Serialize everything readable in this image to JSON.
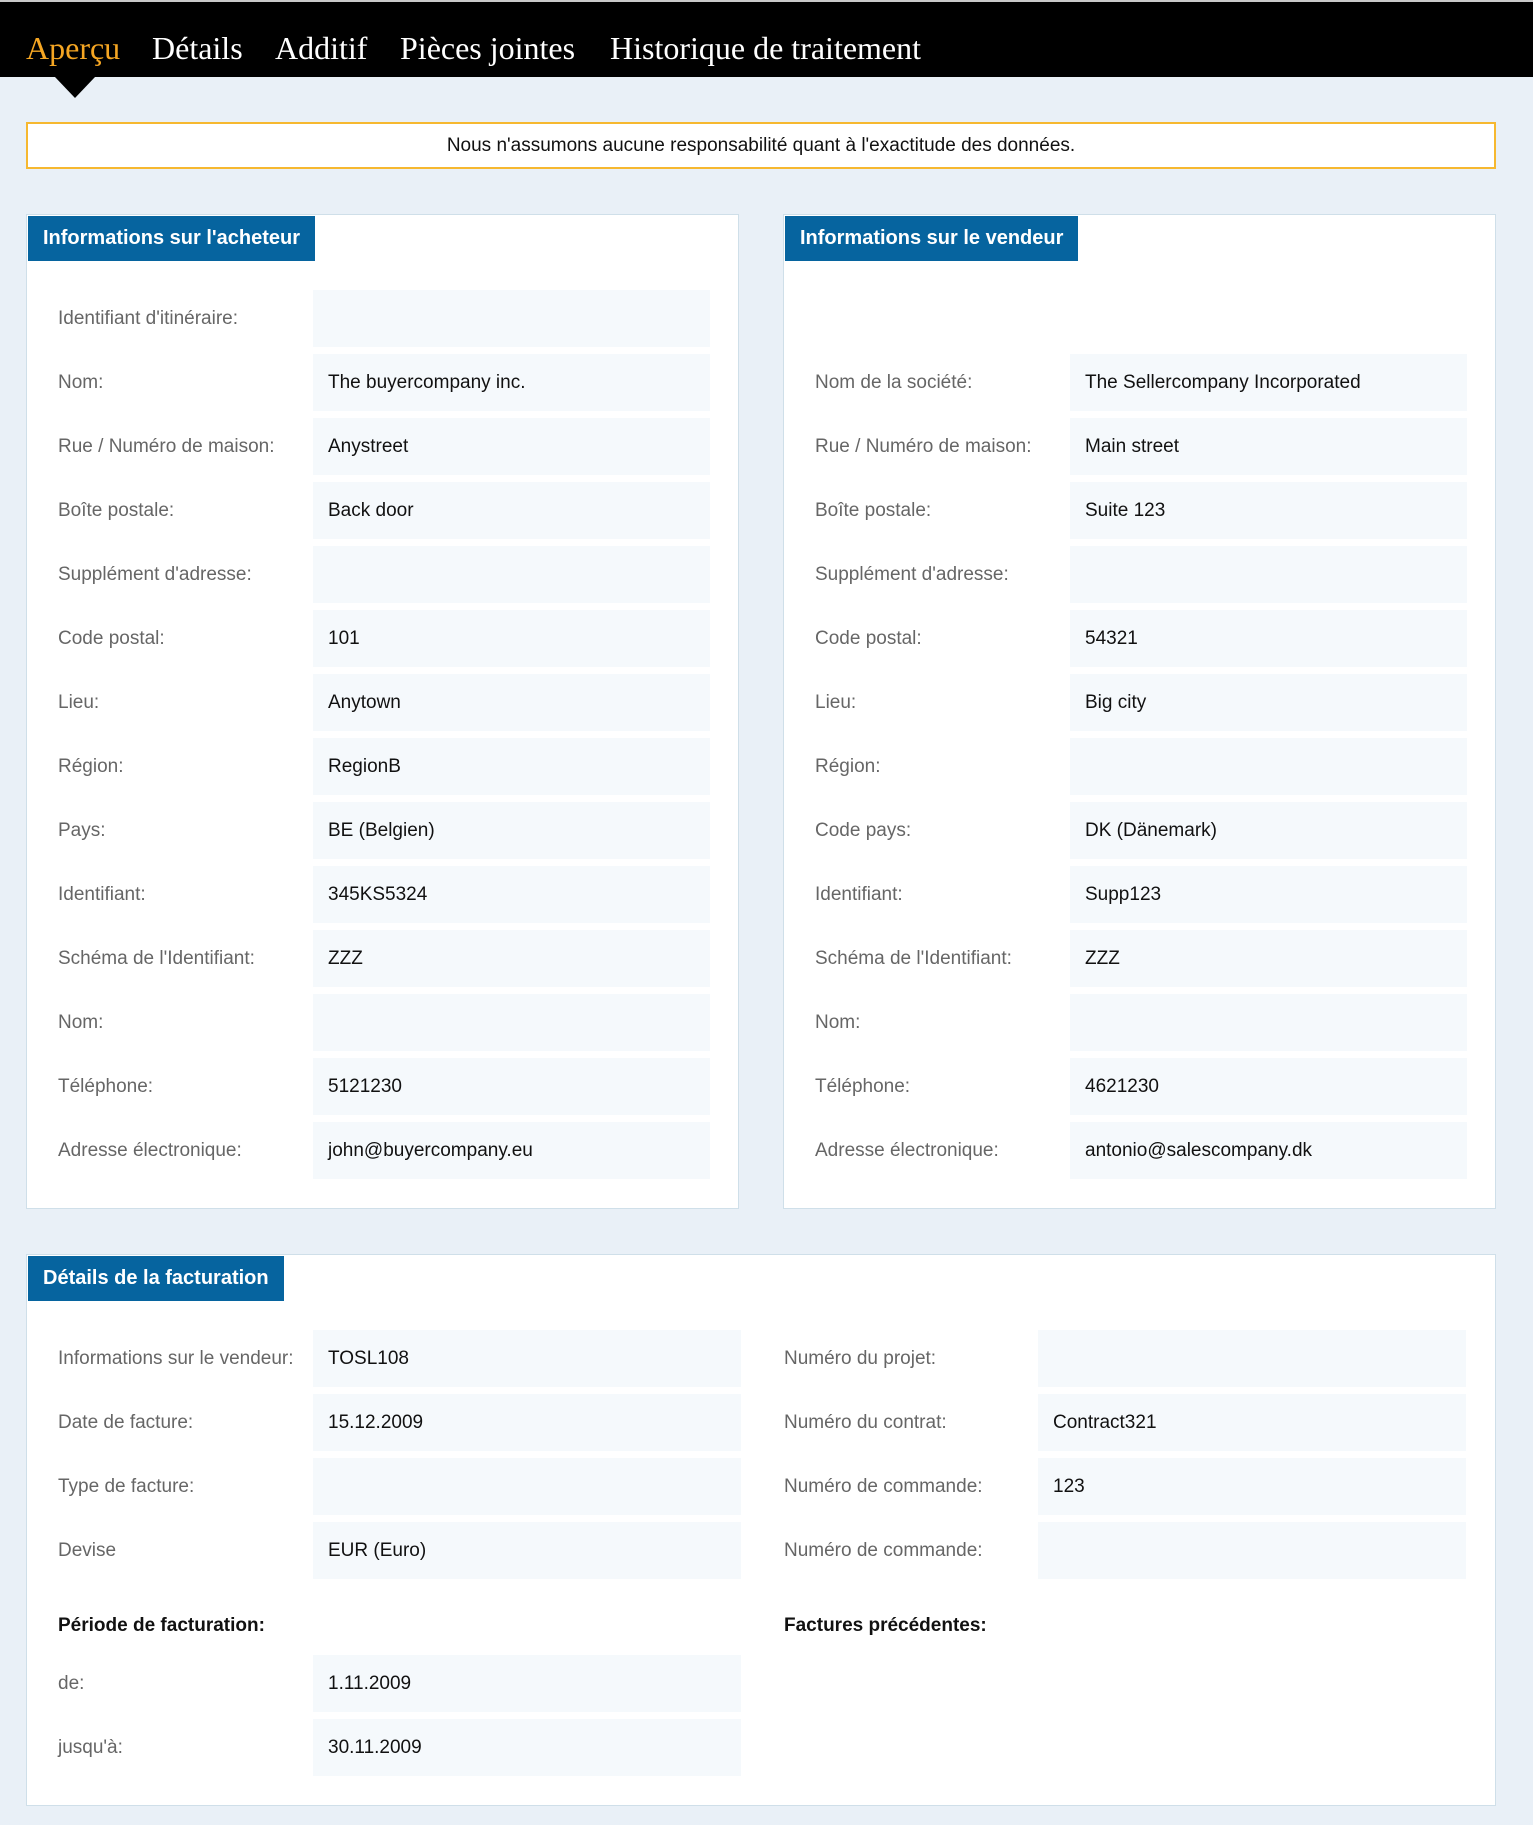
{
  "nav": {
    "tabs": [
      {
        "label": "Aperçu",
        "active": true
      },
      {
        "label": "Détails",
        "active": false
      },
      {
        "label": "Additif",
        "active": false
      },
      {
        "label": "Pièces jointes",
        "active": false
      },
      {
        "label": "Historique de traitement",
        "active": false
      }
    ]
  },
  "notice": "Nous n'assumons aucune responsabilité quant à l'exactitude des données.",
  "buyer": {
    "title": "Informations sur l'acheteur",
    "rows": [
      {
        "label": "Identifiant d'itinéraire:",
        "value": ""
      },
      {
        "label": "Nom:",
        "value": "The buyercompany inc."
      },
      {
        "label": "Rue / Numéro de maison:",
        "value": "Anystreet"
      },
      {
        "label": "Boîte postale:",
        "value": "Back door"
      },
      {
        "label": "Supplément d'adresse:",
        "value": ""
      },
      {
        "label": "Code postal:",
        "value": "101"
      },
      {
        "label": "Lieu:",
        "value": "Anytown"
      },
      {
        "label": "Région:",
        "value": "RegionB"
      },
      {
        "label": "Pays:",
        "value": "BE (Belgien)"
      },
      {
        "label": "Identifiant:",
        "value": "345KS5324"
      },
      {
        "label": "Schéma de l'Identifiant:",
        "value": "ZZZ"
      },
      {
        "label": "Nom:",
        "value": ""
      },
      {
        "label": "Téléphone:",
        "value": "5121230"
      },
      {
        "label": "Adresse électronique:",
        "value": "john@buyercompany.eu"
      }
    ]
  },
  "seller": {
    "title": "Informations sur le vendeur",
    "rows": [
      {
        "label": "Nom de la société:",
        "value": "The Sellercompany Incorporated"
      },
      {
        "label": "Rue / Numéro de maison:",
        "value": "Main street"
      },
      {
        "label": "Boîte postale:",
        "value": "Suite 123"
      },
      {
        "label": "Supplément d'adresse:",
        "value": ""
      },
      {
        "label": "Code postal:",
        "value": "54321"
      },
      {
        "label": "Lieu:",
        "value": "Big city"
      },
      {
        "label": "Région:",
        "value": ""
      },
      {
        "label": "Code pays:",
        "value": "DK (Dänemark)"
      },
      {
        "label": "Identifiant:",
        "value": "Supp123"
      },
      {
        "label": "Schéma de l'Identifiant:",
        "value": "ZZZ"
      },
      {
        "label": "Nom:",
        "value": ""
      },
      {
        "label": "Téléphone:",
        "value": "4621230"
      },
      {
        "label": "Adresse électronique:",
        "value": "antonio@salescompany.dk"
      }
    ]
  },
  "billing": {
    "title": "Détails de la facturation",
    "left_rows": [
      {
        "label": "Informations sur le vendeur:",
        "value": "TOSL108"
      },
      {
        "label": "Date de facture:",
        "value": "15.12.2009"
      },
      {
        "label": "Type de facture:",
        "value": ""
      },
      {
        "label": "Devise",
        "value": "EUR (Euro)"
      }
    ],
    "right_rows": [
      {
        "label": "Numéro du projet:",
        "value": ""
      },
      {
        "label": "Numéro du contrat:",
        "value": "Contract321"
      },
      {
        "label": "Numéro de commande:",
        "value": "123"
      },
      {
        "label": "Numéro de commande:",
        "value": ""
      }
    ],
    "period_heading": "Période de facturation:",
    "period_rows": [
      {
        "label": "de:",
        "value": "1.11.2009"
      },
      {
        "label": "jusqu'à:",
        "value": "30.11.2009"
      }
    ],
    "previous_invoices_heading": "Factures précédentes:"
  }
}
